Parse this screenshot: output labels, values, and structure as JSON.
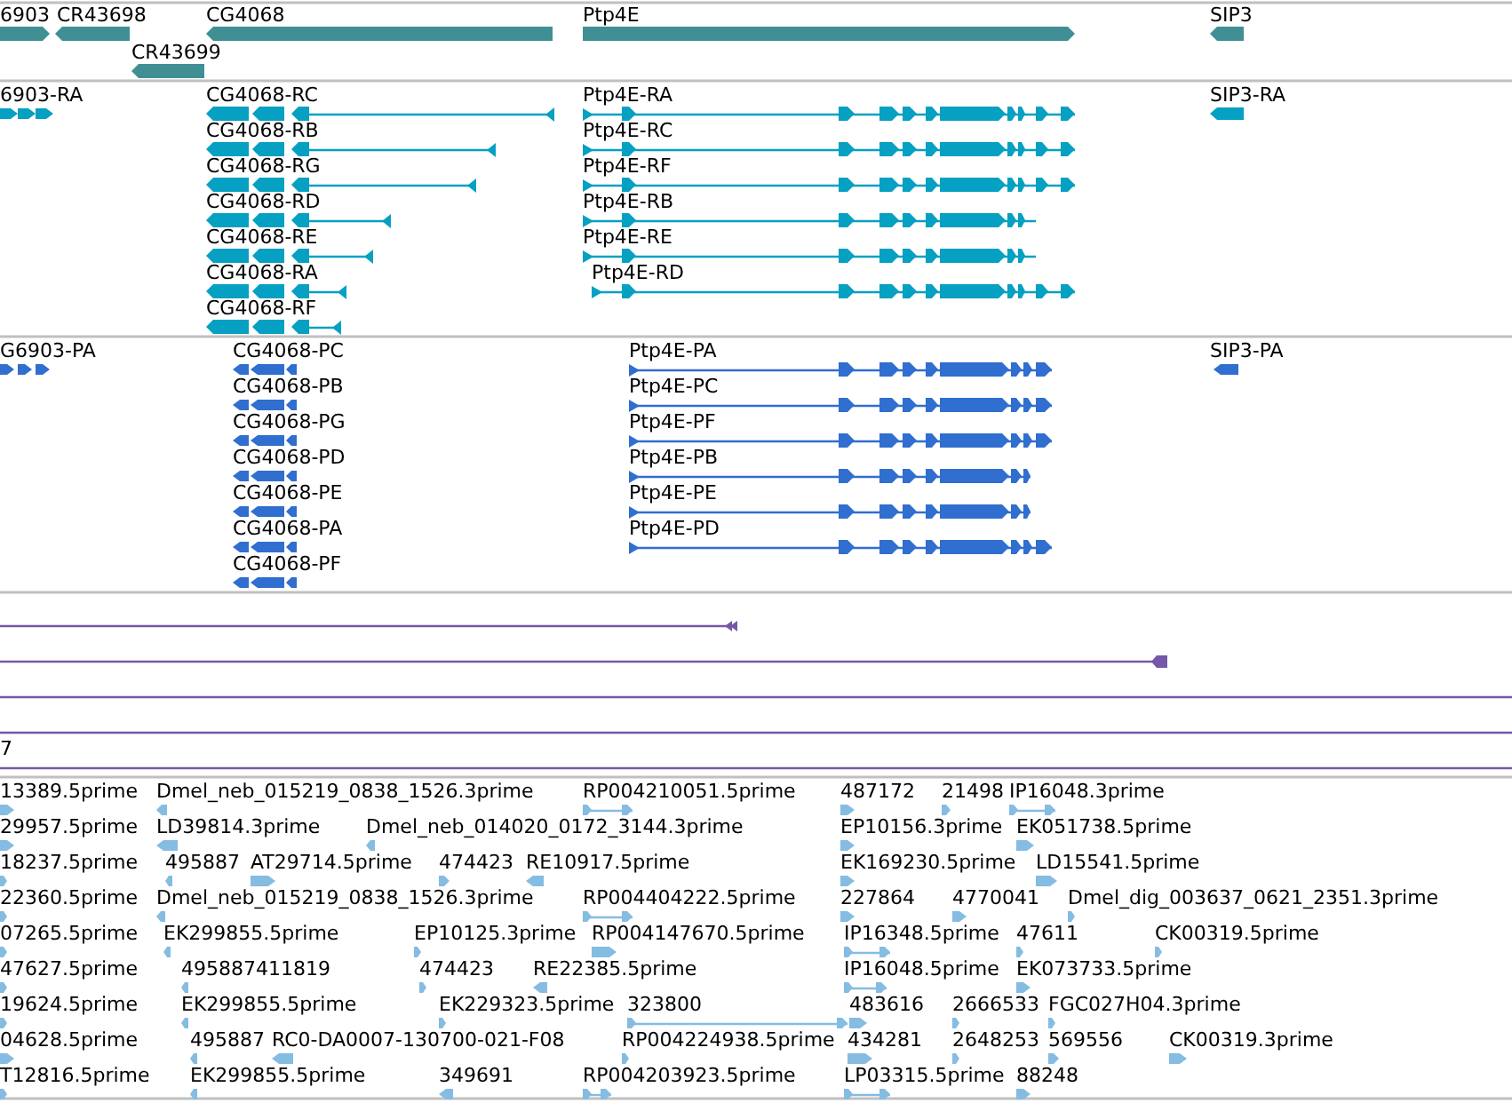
{
  "tracks": [
    {
      "kind": "gene",
      "features": [
        {
          "label": "6903"
        },
        {
          "label": "CR43698"
        },
        {
          "label": "CG4068"
        },
        {
          "label": "Ptp4E"
        },
        {
          "label": "SIP3"
        },
        {
          "label": "CR43699"
        }
      ]
    },
    {
      "kind": "transcript",
      "features": [
        {
          "label": "6903-RA"
        },
        {
          "label": "CG4068-RC"
        },
        {
          "label": "CG4068-RB"
        },
        {
          "label": "CG4068-RG"
        },
        {
          "label": "CG4068-RD"
        },
        {
          "label": "CG4068-RE"
        },
        {
          "label": "CG4068-RA"
        },
        {
          "label": "CG4068-RF"
        },
        {
          "label": "Ptp4E-RA"
        },
        {
          "label": "Ptp4E-RC"
        },
        {
          "label": "Ptp4E-RF"
        },
        {
          "label": "Ptp4E-RB"
        },
        {
          "label": "Ptp4E-RE"
        },
        {
          "label": "Ptp4E-RD"
        },
        {
          "label": "SIP3-RA"
        }
      ]
    },
    {
      "kind": "protein",
      "features": [
        {
          "label": "G6903-PA"
        },
        {
          "label": "CG4068-PC"
        },
        {
          "label": "CG4068-PB"
        },
        {
          "label": "CG4068-PG"
        },
        {
          "label": "CG4068-PD"
        },
        {
          "label": "CG4068-PE"
        },
        {
          "label": "CG4068-PA"
        },
        {
          "label": "CG4068-PF"
        },
        {
          "label": "Ptp4E-PA"
        },
        {
          "label": "Ptp4E-PC"
        },
        {
          "label": "Ptp4E-PF"
        },
        {
          "label": "Ptp4E-PB"
        },
        {
          "label": "Ptp4E-PE"
        },
        {
          "label": "Ptp4E-PD"
        },
        {
          "label": "SIP3-PA"
        }
      ]
    },
    {
      "kind": "alignment",
      "labels": [
        "7"
      ]
    },
    {
      "kind": "est",
      "lanes": [
        {
          "features": [
            {
              "label": "13389.5prime"
            },
            {
              "label": "Dmel_neb_015219_0838_1526.3prime"
            },
            {
              "label": "RP004210051.5prime"
            },
            {
              "label": "487172"
            },
            {
              "label": "21498"
            },
            {
              "label": "IP16048.3prime"
            }
          ]
        },
        {
          "features": [
            {
              "label": "29957.5prime"
            },
            {
              "label": "LD39814.3prime"
            },
            {
              "label": "Dmel_neb_014020_0172_3144.3prime"
            },
            {
              "label": "EP10156.3prime"
            },
            {
              "label": "EK051738.5prime"
            }
          ]
        },
        {
          "features": [
            {
              "label": "18237.5prime"
            },
            {
              "label": "495887"
            },
            {
              "label": "AT29714.5prime"
            },
            {
              "label": "474423"
            },
            {
              "label": "RE10917.5prime"
            },
            {
              "label": "EK169230.5prime"
            },
            {
              "label": "LD15541.5prime"
            }
          ]
        },
        {
          "features": [
            {
              "label": "22360.5prime"
            },
            {
              "label": "Dmel_neb_015219_0838_1526.3prime"
            },
            {
              "label": "RP004404222.5prime"
            },
            {
              "label": "227864"
            },
            {
              "label": "4770041"
            },
            {
              "label": "Dmel_dig_003637_0621_2351.3prime"
            }
          ]
        },
        {
          "features": [
            {
              "label": "07265.5prime"
            },
            {
              "label": "EK299855.5prime"
            },
            {
              "label": "EP10125.3prime"
            },
            {
              "label": "RP004147670.5prime"
            },
            {
              "label": "IP16348.5prime"
            },
            {
              "label": "47611"
            },
            {
              "label": "CK00319.5prime"
            }
          ]
        },
        {
          "features": [
            {
              "label": "47627.5prime"
            },
            {
              "label": "495887411819"
            },
            {
              "label": "474423"
            },
            {
              "label": "RE22385.5prime"
            },
            {
              "label": "IP16048.5prime"
            },
            {
              "label": "EK073733.5prime"
            }
          ]
        },
        {
          "features": [
            {
              "label": "19624.5prime"
            },
            {
              "label": "EK299855.5prime"
            },
            {
              "label": "EK229323.5prime"
            },
            {
              "label": "323800"
            },
            {
              "label": "483616"
            },
            {
              "label": "2666533"
            },
            {
              "label": "FGC027H04.3prime"
            }
          ]
        },
        {
          "features": [
            {
              "label": "04628.5prime"
            },
            {
              "label": "495887"
            },
            {
              "label": "RC0-DA0007-130700-021-F08"
            },
            {
              "label": "RP004224938.5prime"
            },
            {
              "label": "434281"
            },
            {
              "label": "2648253"
            },
            {
              "label": "569556"
            },
            {
              "label": "CK00319.3prime"
            }
          ]
        },
        {
          "features": [
            {
              "label": "T12816.5prime"
            },
            {
              "label": "EK299855.5prime"
            },
            {
              "label": "349691"
            },
            {
              "label": "RP004203923.5prime"
            },
            {
              "label": "LP03315.5prime"
            },
            {
              "label": "88248"
            }
          ]
        }
      ]
    }
  ]
}
